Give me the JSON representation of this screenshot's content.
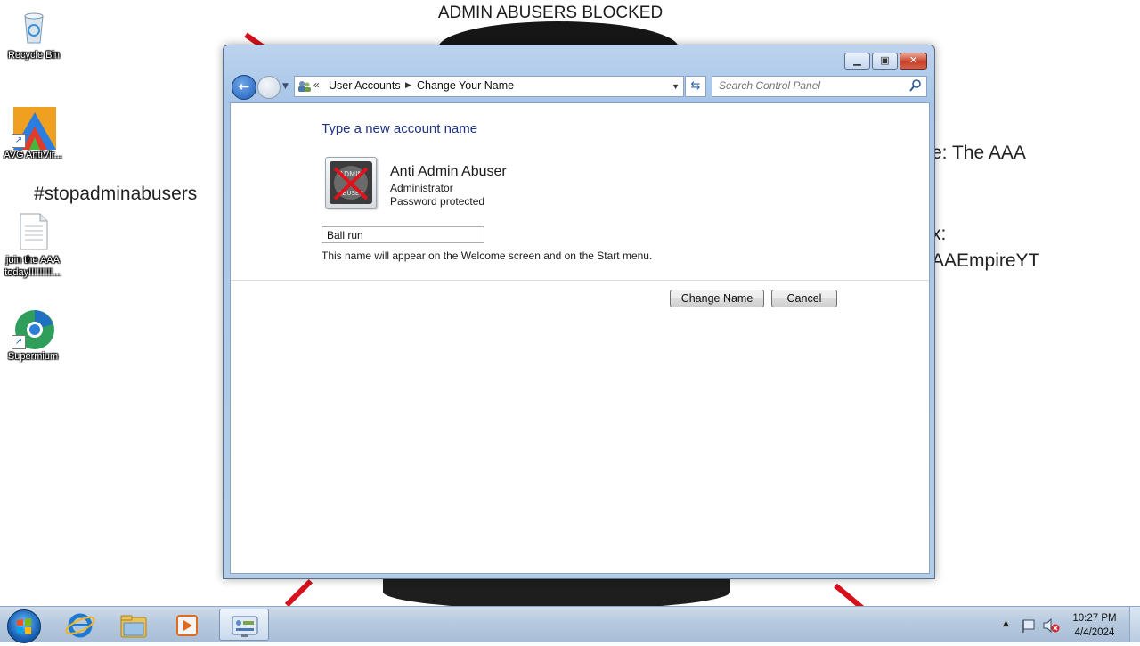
{
  "wallpaper": {
    "banner": "ADMIN ABUSERS BLOCKED",
    "hashtag": "#stopadminabusers",
    "right_line1": "e: The AAA",
    "right_line2": "x:",
    "right_line3": "AAEmpireYT"
  },
  "desktop_icons": [
    {
      "label": "Recycle Bin",
      "icon": "recycle-bin-icon"
    },
    {
      "label": "AVG AntiVir...",
      "icon": "avg-antivirus-icon"
    },
    {
      "label": "join the AAA today!!!!!!!!!...",
      "icon": "text-document-icon"
    },
    {
      "label": "Supermium",
      "icon": "supermium-browser-icon"
    }
  ],
  "window": {
    "breadcrumb": {
      "overflow": "«",
      "items": [
        "User Accounts",
        "Change Your Name"
      ]
    },
    "search_placeholder": "Search Control Panel",
    "heading": "Type a new account name",
    "account": {
      "name": "Anti Admin Abuser",
      "type": "Administrator",
      "protection": "Password protected",
      "avatar_text_top": "ADMIN",
      "avatar_text_bottom": "ABUSER"
    },
    "name_field_value": "Ball run",
    "hint": "This name will appear on the Welcome screen and on the Start menu.",
    "buttons": {
      "change": "Change Name",
      "cancel": "Cancel"
    }
  },
  "taskbar": {
    "pinned": [
      "internet-explorer-icon",
      "windows-explorer-icon",
      "media-player-icon",
      "control-panel-icon"
    ],
    "active": "control-panel-icon",
    "clock_time": "10:27 PM",
    "clock_date": "4/4/2024"
  },
  "colors": {
    "heading_blue": "#1e3287",
    "window_frame": "#b3cde9",
    "close_red": "#c7412a",
    "wallpaper_red": "#d8101c"
  }
}
